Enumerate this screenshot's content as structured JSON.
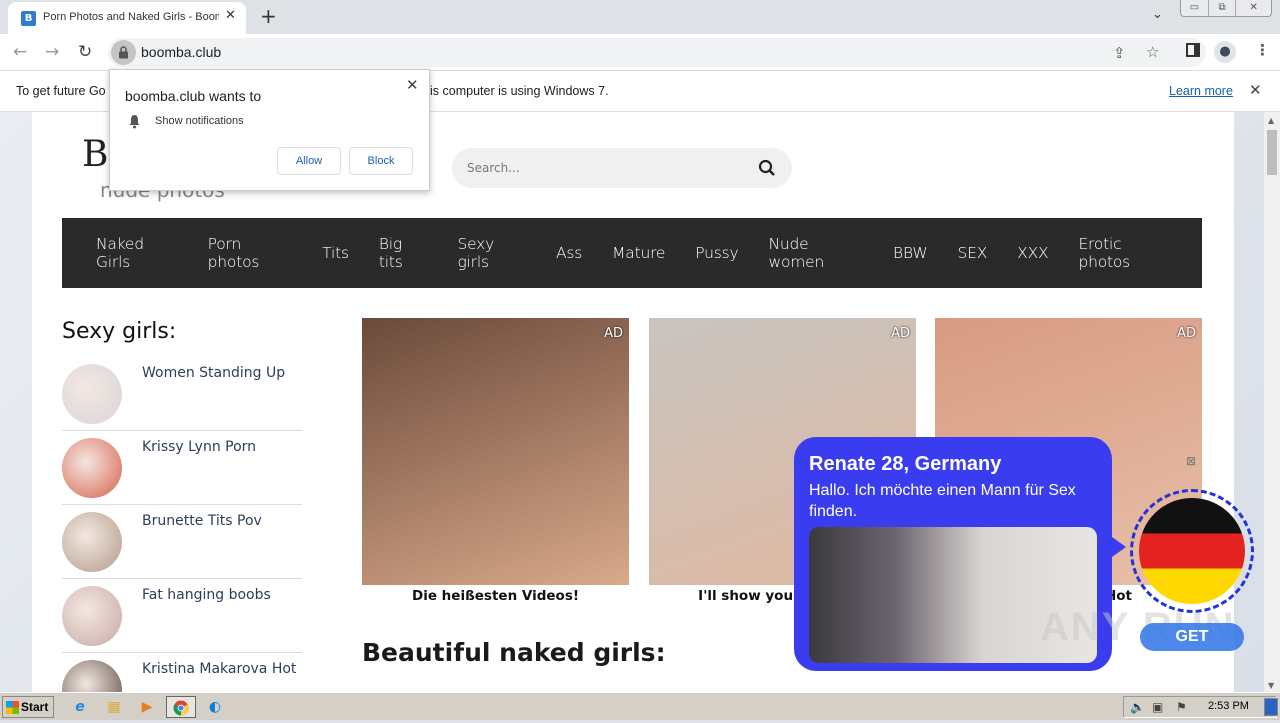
{
  "browser": {
    "tab": {
      "favicon_letter": "B",
      "title": "Porn Photos and Naked Girls - Boomba",
      "close_icon": "close-icon"
    },
    "new_tab": "+",
    "tab_search": "⌄",
    "window_controls": [
      "▭",
      "⧉",
      "✕"
    ],
    "url": "boomba.club",
    "infobar": {
      "message_left": "To get future Go",
      "message_right": "is computer is using Windows 7.",
      "learn_more": "Learn more",
      "close": "✕"
    }
  },
  "permission_popup": {
    "title": "boomba.club wants to",
    "item": "Show notifications",
    "allow": "Allow",
    "block": "Block",
    "close": "✕"
  },
  "site": {
    "logo_letter": "B",
    "logo_tagline": "nude photos",
    "search": {
      "placeholder": "Search..."
    },
    "nav": [
      "Naked Girls",
      "Porn photos",
      "Tits",
      "Big tits",
      "Sexy girls",
      "Ass",
      "Mature",
      "Pussy",
      "Nude women",
      "BBW",
      "SEX",
      "XXX",
      "Erotic photos"
    ],
    "sidebar": {
      "title": "Sexy girls:",
      "items": [
        {
          "label": "Women Standing Up",
          "color": "#d9d4d6"
        },
        {
          "label": "Krissy Lynn Porn",
          "color": "#d8604a"
        },
        {
          "label": "Brunette Tits Pov",
          "color": "#b39a88"
        },
        {
          "label": "Fat hanging boobs",
          "color": "#c7a8a4"
        },
        {
          "label": "Kristina Makarova Hot",
          "color": "#5a4a3e"
        }
      ]
    },
    "ads": [
      {
        "tag": "AD",
        "caption": "Die heißesten Videos!",
        "color_a": "#6b4a3a",
        "color_b": "#d9a98a"
      },
      {
        "tag": "AD",
        "caption": "I'll show you if you see.",
        "color_a": "#c8c4c0",
        "color_b": "#e0b8a0"
      },
      {
        "tag": "AD",
        "caption": "Hot",
        "color_a": "#d89a82",
        "color_b": "#e8c0a8"
      }
    ],
    "section_heading": "Beautiful naked girls:"
  },
  "chat_ad": {
    "name": "Renate 28, Germany",
    "message": "Hallo. Ich möchte einen Mann für Sex finden.",
    "get_button": "GET",
    "accent": "#3a3cf0"
  },
  "watermark": "ANY RUN",
  "taskbar": {
    "start": "Start",
    "apps": [
      "internet-explorer",
      "file-explorer",
      "media-player",
      "chrome",
      "edge"
    ],
    "clock": "2:53 PM"
  }
}
